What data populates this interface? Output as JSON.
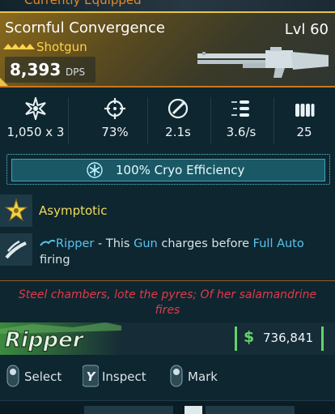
{
  "top": {
    "equipped_label": "Currently Equipped"
  },
  "item": {
    "name": "Scornful Convergence",
    "level": "Lvl 60",
    "type": "Shotgun",
    "dps_value": "8,393",
    "dps_label": "DPS",
    "rarity_color": "#ffd24a"
  },
  "stats": [
    {
      "icon": "damage-burst-icon",
      "value": "1,050 x 3"
    },
    {
      "icon": "accuracy-crosshair-icon",
      "value": "73%"
    },
    {
      "icon": "reload-time-icon",
      "value": "2.1s"
    },
    {
      "icon": "fire-rate-icon",
      "value": "3.6/s"
    },
    {
      "icon": "magazine-size-icon",
      "value": "25"
    }
  ],
  "element": {
    "icon": "snowflake-icon",
    "label": "100% Cryo Efficiency",
    "color": "#1a5866"
  },
  "perks": [
    {
      "icon": "asymptotic-star-icon",
      "title": "Asymptotic"
    },
    {
      "icon": "ripper-slash-icon",
      "desc_parts": {
        "manufacturer": "Ripper",
        "t1": " - This ",
        "gun": "Gun",
        "t2": " charges before ",
        "mode": "Full Auto",
        "t3": " firing"
      }
    }
  ],
  "flavor_text": "Steel chambers, lote the pyres; Of her salamandrine fires",
  "brand": {
    "logo_text": "Ripper"
  },
  "price": {
    "currency_symbol": "$",
    "amount": "736,841",
    "color": "#62d46a"
  },
  "actions": [
    {
      "button": "left-stick-button-icon",
      "label": "Select"
    },
    {
      "button": "y-button-icon",
      "button_text": "Y",
      "label": "Inspect"
    },
    {
      "button": "right-stick-button-icon",
      "label": "Mark"
    }
  ],
  "colors": {
    "accent_orange": "#c9781f",
    "keyword_blue": "#58c4f0",
    "flavor_red": "#e23a4a",
    "perk_gold": "#f2dd5a"
  }
}
